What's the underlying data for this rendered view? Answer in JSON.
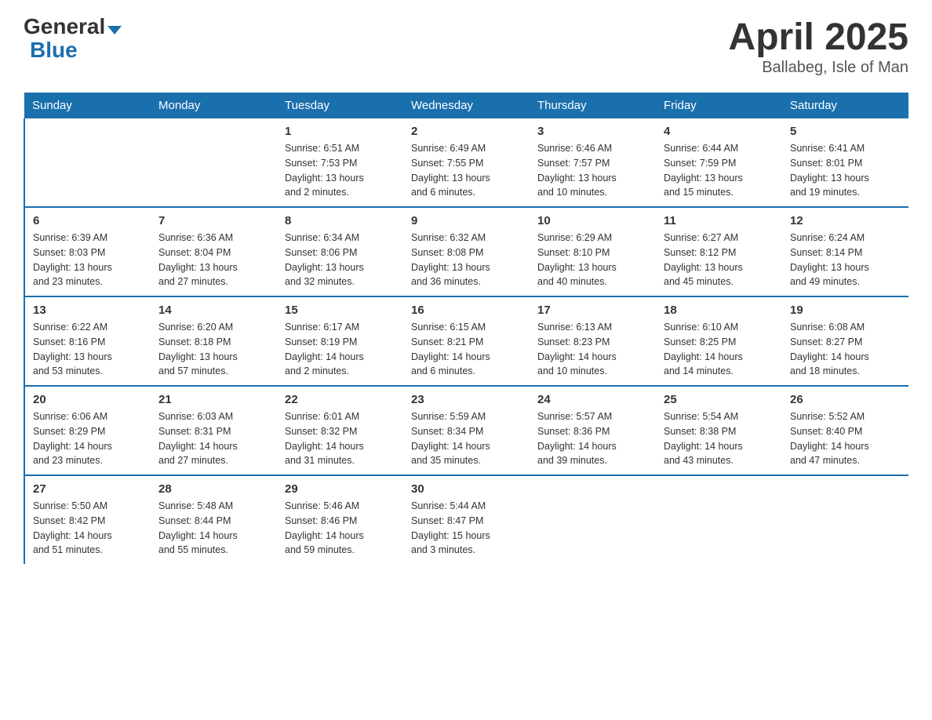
{
  "header": {
    "logo_general": "General",
    "logo_blue": "Blue",
    "month_year": "April 2025",
    "location": "Ballabeg, Isle of Man"
  },
  "days_of_week": [
    "Sunday",
    "Monday",
    "Tuesday",
    "Wednesday",
    "Thursday",
    "Friday",
    "Saturday"
  ],
  "weeks": [
    [
      {
        "day": "",
        "info": ""
      },
      {
        "day": "",
        "info": ""
      },
      {
        "day": "1",
        "info": "Sunrise: 6:51 AM\nSunset: 7:53 PM\nDaylight: 13 hours\nand 2 minutes."
      },
      {
        "day": "2",
        "info": "Sunrise: 6:49 AM\nSunset: 7:55 PM\nDaylight: 13 hours\nand 6 minutes."
      },
      {
        "day": "3",
        "info": "Sunrise: 6:46 AM\nSunset: 7:57 PM\nDaylight: 13 hours\nand 10 minutes."
      },
      {
        "day": "4",
        "info": "Sunrise: 6:44 AM\nSunset: 7:59 PM\nDaylight: 13 hours\nand 15 minutes."
      },
      {
        "day": "5",
        "info": "Sunrise: 6:41 AM\nSunset: 8:01 PM\nDaylight: 13 hours\nand 19 minutes."
      }
    ],
    [
      {
        "day": "6",
        "info": "Sunrise: 6:39 AM\nSunset: 8:03 PM\nDaylight: 13 hours\nand 23 minutes."
      },
      {
        "day": "7",
        "info": "Sunrise: 6:36 AM\nSunset: 8:04 PM\nDaylight: 13 hours\nand 27 minutes."
      },
      {
        "day": "8",
        "info": "Sunrise: 6:34 AM\nSunset: 8:06 PM\nDaylight: 13 hours\nand 32 minutes."
      },
      {
        "day": "9",
        "info": "Sunrise: 6:32 AM\nSunset: 8:08 PM\nDaylight: 13 hours\nand 36 minutes."
      },
      {
        "day": "10",
        "info": "Sunrise: 6:29 AM\nSunset: 8:10 PM\nDaylight: 13 hours\nand 40 minutes."
      },
      {
        "day": "11",
        "info": "Sunrise: 6:27 AM\nSunset: 8:12 PM\nDaylight: 13 hours\nand 45 minutes."
      },
      {
        "day": "12",
        "info": "Sunrise: 6:24 AM\nSunset: 8:14 PM\nDaylight: 13 hours\nand 49 minutes."
      }
    ],
    [
      {
        "day": "13",
        "info": "Sunrise: 6:22 AM\nSunset: 8:16 PM\nDaylight: 13 hours\nand 53 minutes."
      },
      {
        "day": "14",
        "info": "Sunrise: 6:20 AM\nSunset: 8:18 PM\nDaylight: 13 hours\nand 57 minutes."
      },
      {
        "day": "15",
        "info": "Sunrise: 6:17 AM\nSunset: 8:19 PM\nDaylight: 14 hours\nand 2 minutes."
      },
      {
        "day": "16",
        "info": "Sunrise: 6:15 AM\nSunset: 8:21 PM\nDaylight: 14 hours\nand 6 minutes."
      },
      {
        "day": "17",
        "info": "Sunrise: 6:13 AM\nSunset: 8:23 PM\nDaylight: 14 hours\nand 10 minutes."
      },
      {
        "day": "18",
        "info": "Sunrise: 6:10 AM\nSunset: 8:25 PM\nDaylight: 14 hours\nand 14 minutes."
      },
      {
        "day": "19",
        "info": "Sunrise: 6:08 AM\nSunset: 8:27 PM\nDaylight: 14 hours\nand 18 minutes."
      }
    ],
    [
      {
        "day": "20",
        "info": "Sunrise: 6:06 AM\nSunset: 8:29 PM\nDaylight: 14 hours\nand 23 minutes."
      },
      {
        "day": "21",
        "info": "Sunrise: 6:03 AM\nSunset: 8:31 PM\nDaylight: 14 hours\nand 27 minutes."
      },
      {
        "day": "22",
        "info": "Sunrise: 6:01 AM\nSunset: 8:32 PM\nDaylight: 14 hours\nand 31 minutes."
      },
      {
        "day": "23",
        "info": "Sunrise: 5:59 AM\nSunset: 8:34 PM\nDaylight: 14 hours\nand 35 minutes."
      },
      {
        "day": "24",
        "info": "Sunrise: 5:57 AM\nSunset: 8:36 PM\nDaylight: 14 hours\nand 39 minutes."
      },
      {
        "day": "25",
        "info": "Sunrise: 5:54 AM\nSunset: 8:38 PM\nDaylight: 14 hours\nand 43 minutes."
      },
      {
        "day": "26",
        "info": "Sunrise: 5:52 AM\nSunset: 8:40 PM\nDaylight: 14 hours\nand 47 minutes."
      }
    ],
    [
      {
        "day": "27",
        "info": "Sunrise: 5:50 AM\nSunset: 8:42 PM\nDaylight: 14 hours\nand 51 minutes."
      },
      {
        "day": "28",
        "info": "Sunrise: 5:48 AM\nSunset: 8:44 PM\nDaylight: 14 hours\nand 55 minutes."
      },
      {
        "day": "29",
        "info": "Sunrise: 5:46 AM\nSunset: 8:46 PM\nDaylight: 14 hours\nand 59 minutes."
      },
      {
        "day": "30",
        "info": "Sunrise: 5:44 AM\nSunset: 8:47 PM\nDaylight: 15 hours\nand 3 minutes."
      },
      {
        "day": "",
        "info": ""
      },
      {
        "day": "",
        "info": ""
      },
      {
        "day": "",
        "info": ""
      }
    ]
  ]
}
